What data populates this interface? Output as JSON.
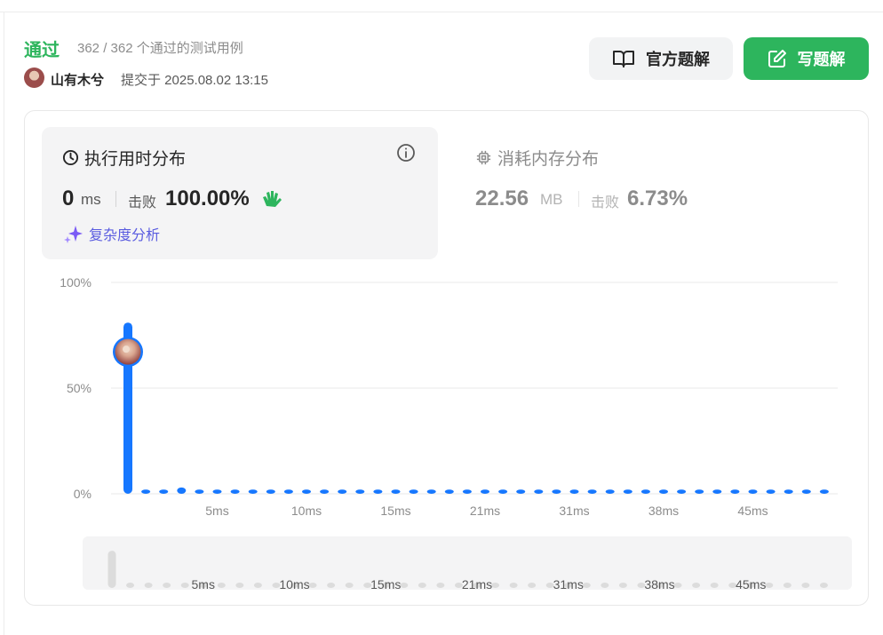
{
  "submission": {
    "status": "通过",
    "tests_passed": "362 / 362",
    "tests_suffix": "个通过的测试用例",
    "user_name": "山有木兮",
    "submitted_label": "提交于 2025.08.02 13:15"
  },
  "buttons": {
    "official_solution": "官方题解",
    "write_solution": "写题解"
  },
  "runtime": {
    "title": "执行用时分布",
    "value": "0",
    "unit": "ms",
    "beats_label": "击败",
    "beats_value": "100.00%",
    "complexity_label": "复杂度分析"
  },
  "memory": {
    "title": "消耗内存分布",
    "value": "22.56",
    "unit": "MB",
    "beats_label": "击败",
    "beats_value": "6.73%"
  },
  "colors": {
    "accent_green": "#2db55d",
    "bar_blue": "#1677ff",
    "complexity_purple": "#5a5ce0"
  },
  "chart_data": {
    "type": "bar",
    "y_ticks": [
      "100%",
      "50%",
      "0%"
    ],
    "ylim": [
      0,
      100
    ],
    "x_tick_labels": [
      "5ms",
      "10ms",
      "15ms",
      "21ms",
      "31ms",
      "38ms",
      "45ms"
    ],
    "values": [
      81,
      2,
      2,
      3,
      2,
      2,
      2,
      2,
      2,
      2,
      2,
      2,
      2,
      2,
      2,
      2,
      2,
      2,
      2,
      2,
      2,
      2,
      2,
      2,
      2,
      2,
      2,
      2,
      2,
      2,
      2,
      2,
      2,
      2,
      2,
      2,
      2,
      2,
      2,
      2
    ],
    "user_marker_value": 68,
    "user_marker_index": 0,
    "grid": true,
    "overview_tick_labels": [
      "5ms",
      "10ms",
      "15ms",
      "21ms",
      "31ms",
      "38ms",
      "45ms"
    ]
  }
}
